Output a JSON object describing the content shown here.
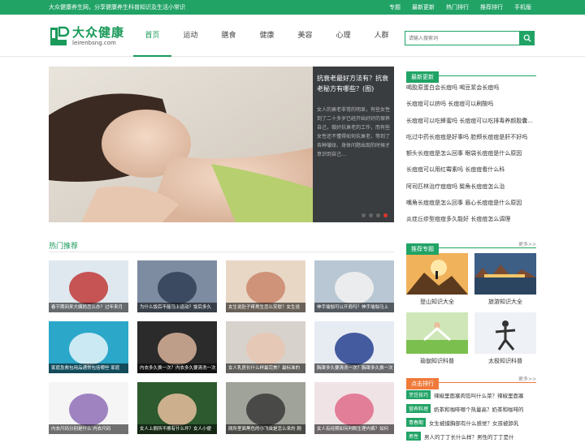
{
  "topbar": {
    "tagline": "大众健康养生网，分享健康养生科普知识及生活小常识",
    "links": [
      "专题",
      "最新更新",
      "热门排行",
      "推荐排行",
      "手机版"
    ]
  },
  "logo": {
    "cn": "大众健康",
    "en": "leirenbsng.com"
  },
  "nav": [
    "首页",
    "运动",
    "膳食",
    "健康",
    "美容",
    "心理",
    "人群"
  ],
  "search": {
    "placeholder": "请输入搜索词"
  },
  "banner": {
    "title": "抗衰老最好方法有？抗衰老秘方有哪些？(图)",
    "desc": "女人的衰老非常的明显，有些女性到了二十多岁已经开始好好的保养自己，做好抗衰老的工作，而有些女性还不懂得如何抗衰老，等到了各种皱纹、身体问题出现的时候才意识到自己..."
  },
  "hot": {
    "title": "热门推荐",
    "items": [
      "春节期间来大姨妈怎么办？过年来月",
      "为什么饭后不能马上运动？饭后多久",
      "女生说肚子疼男生怎么安慰？女生说",
      "伸手瑜伽可以开肩吗？伸手瑜伽马上",
      "家庭急救包用品通常包括哪些 家庭",
      "内衣多久换一次？内衣多久要清洗一次",
      "女人乳房长什么样最完美？最标准的",
      "胸罩多久要清洗一次？胸罩多久换一次",
      "内衣尺码分别是什么 内衣尺码",
      "女人上厕所不擦有什么坏？女人小便",
      "厕所里面黑色的小飞虫是怎么来的 厕",
      "女人有经期如何判断生理内裤？如何"
    ]
  },
  "latest": {
    "title": "最新更新",
    "items": [
      "喝胶原蛋白会长痘吗 喝豆浆会长痘吗",
      "长痘痘可以挤吗 长痘痘可以刷酸吗",
      "长痘痘可以吃蜂蜜吗 长痘痘可以吃排毒养颜胶囊...",
      "吃过中药长痘痘是好事吗 脸颊长痘痘是肝不好吗",
      "额头长痘痘是怎么回事 眼袋长痘痘是什么原因",
      "长痘痘可以用红霉素吗 长痘痘看什么科",
      "阿司匹林治疗痘痘吗 鬓角长痘痘怎么治",
      "嘴角长痘痘是怎么回事 眉心长痘痘是什么原因",
      "炎症丘疹型痘痘多久能好 长痘痘怎么调理"
    ]
  },
  "topics": {
    "title": "推荐专题",
    "more": "更多>>",
    "items": [
      "登山知识大全",
      "旅游知识大全",
      "瑜伽知识科普",
      "太极知识科普"
    ]
  },
  "ranking": {
    "title": "点击排行",
    "more": "更多>>",
    "items": [
      {
        "tag": "烹饪技巧",
        "text": "辣椒里面塞肉馅叫什么菜？辣椒里面塞"
      },
      {
        "tag": "营养料理",
        "text": "奶茶和咖啡哪个热量高？奶茶和咖啡的"
      },
      {
        "tag": "青春期",
        "text": "女生被摸胸部有什么感觉？女孩被舔乳"
      },
      {
        "tag": "男性",
        "text": "男人的丁丁长什么样？男性的丁丁是什"
      }
    ]
  },
  "colors": {
    "accent": "#21a366",
    "dot_active": "#e0332a"
  }
}
